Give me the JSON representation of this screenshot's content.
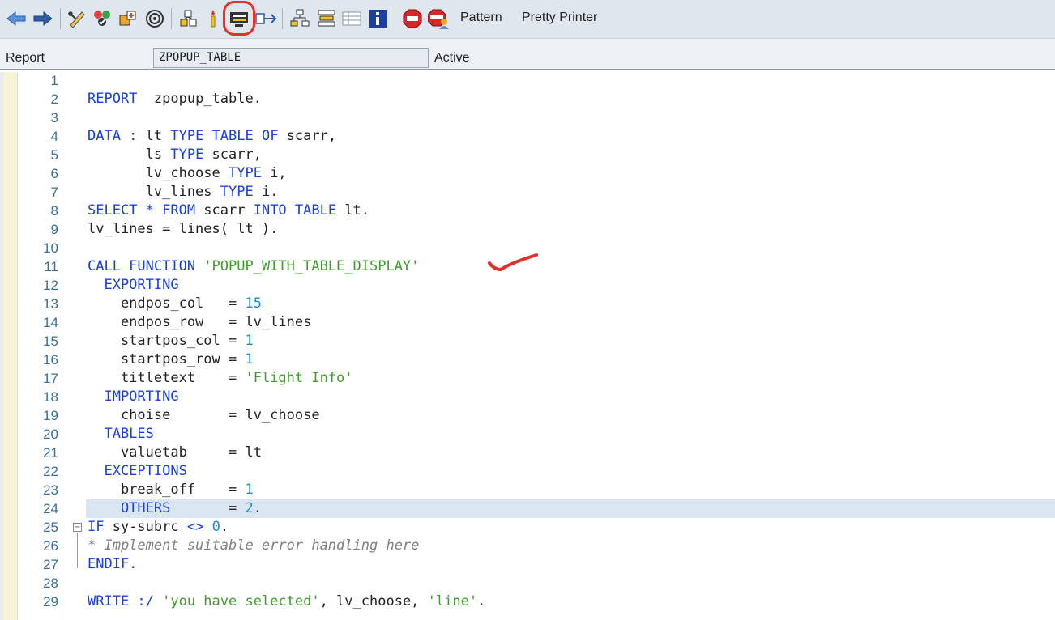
{
  "toolbar": {
    "icons": [
      {
        "name": "back-icon"
      },
      {
        "name": "forward-icon"
      },
      {
        "name": "display-change-icon"
      },
      {
        "name": "check-icon"
      },
      {
        "name": "activate-icon"
      },
      {
        "name": "where-used-icon"
      },
      {
        "name": "object-list-icon"
      },
      {
        "name": "test-icon"
      },
      {
        "name": "enhancement-icon"
      },
      {
        "name": "navigation-window-icon"
      },
      {
        "name": "hierarchy-icon"
      },
      {
        "name": "layout-icon"
      },
      {
        "name": "table-icon"
      },
      {
        "name": "info-icon"
      },
      {
        "name": "stop-breakpoint-icon"
      },
      {
        "name": "stop-user-icon"
      }
    ],
    "pattern_label": "Pattern",
    "pretty_printer_label": "Pretty Printer"
  },
  "header": {
    "object_type": "Report",
    "program_name": "ZPOPUP_TABLE",
    "status": "Active"
  },
  "editor": {
    "current_line": 24,
    "lines": [
      {
        "n": "1",
        "tokens": []
      },
      {
        "n": "2",
        "tokens": [
          {
            "t": "REPORT",
            "c": "kw"
          },
          {
            "t": "  zpopup_table.",
            "c": "pl"
          }
        ]
      },
      {
        "n": "3",
        "tokens": []
      },
      {
        "n": "4",
        "tokens": [
          {
            "t": "DATA : ",
            "c": "kw"
          },
          {
            "t": "lt ",
            "c": "pl"
          },
          {
            "t": "TYPE TABLE OF ",
            "c": "kw"
          },
          {
            "t": "scarr,",
            "c": "pl"
          }
        ]
      },
      {
        "n": "5",
        "tokens": [
          {
            "t": "       ls ",
            "c": "pl"
          },
          {
            "t": "TYPE ",
            "c": "kw"
          },
          {
            "t": "scarr,",
            "c": "pl"
          }
        ]
      },
      {
        "n": "6",
        "tokens": [
          {
            "t": "       lv_choose ",
            "c": "pl"
          },
          {
            "t": "TYPE ",
            "c": "kw"
          },
          {
            "t": "i,",
            "c": "pl"
          }
        ]
      },
      {
        "n": "7",
        "tokens": [
          {
            "t": "       lv_lines ",
            "c": "pl"
          },
          {
            "t": "TYPE ",
            "c": "kw"
          },
          {
            "t": "i.",
            "c": "pl"
          }
        ]
      },
      {
        "n": "8",
        "tokens": [
          {
            "t": "SELECT * FROM ",
            "c": "kw"
          },
          {
            "t": "scarr ",
            "c": "pl"
          },
          {
            "t": "INTO TABLE ",
            "c": "kw"
          },
          {
            "t": "lt.",
            "c": "pl"
          }
        ]
      },
      {
        "n": "9",
        "tokens": [
          {
            "t": "lv_lines = lines( lt ).",
            "c": "pl"
          }
        ]
      },
      {
        "n": "10",
        "tokens": []
      },
      {
        "n": "11",
        "tokens": [
          {
            "t": "CALL FUNCTION ",
            "c": "kw"
          },
          {
            "t": "'POPUP_WITH_TABLE_DISPLAY'",
            "c": "str"
          }
        ]
      },
      {
        "n": "12",
        "tokens": [
          {
            "t": "  EXPORTING",
            "c": "kw"
          }
        ]
      },
      {
        "n": "13",
        "tokens": [
          {
            "t": "    endpos_col   = ",
            "c": "pl"
          },
          {
            "t": "15",
            "c": "num"
          }
        ]
      },
      {
        "n": "14",
        "tokens": [
          {
            "t": "    endpos_row   = lv_lines",
            "c": "pl"
          }
        ]
      },
      {
        "n": "15",
        "tokens": [
          {
            "t": "    startpos_col = ",
            "c": "pl"
          },
          {
            "t": "1",
            "c": "num"
          }
        ]
      },
      {
        "n": "16",
        "tokens": [
          {
            "t": "    startpos_row = ",
            "c": "pl"
          },
          {
            "t": "1",
            "c": "num"
          }
        ]
      },
      {
        "n": "17",
        "tokens": [
          {
            "t": "    titletext    = ",
            "c": "pl"
          },
          {
            "t": "'Flight Info'",
            "c": "str"
          }
        ]
      },
      {
        "n": "18",
        "tokens": [
          {
            "t": "  IMPORTING",
            "c": "kw"
          }
        ]
      },
      {
        "n": "19",
        "tokens": [
          {
            "t": "    choise       = lv_choose",
            "c": "pl"
          }
        ]
      },
      {
        "n": "20",
        "tokens": [
          {
            "t": "  TABLES",
            "c": "kw"
          }
        ]
      },
      {
        "n": "21",
        "tokens": [
          {
            "t": "    valuetab     = lt",
            "c": "pl"
          }
        ]
      },
      {
        "n": "22",
        "tokens": [
          {
            "t": "  EXCEPTIONS",
            "c": "kw"
          }
        ]
      },
      {
        "n": "23",
        "tokens": [
          {
            "t": "    break_off    = ",
            "c": "pl"
          },
          {
            "t": "1",
            "c": "num"
          }
        ]
      },
      {
        "n": "24",
        "tokens": [
          {
            "t": "    OTHERS",
            "c": "kw"
          },
          {
            "t": "       = ",
            "c": "pl"
          },
          {
            "t": "2",
            "c": "num"
          },
          {
            "t": ".",
            "c": "pl"
          }
        ]
      },
      {
        "n": "25",
        "tokens": [
          {
            "t": "IF ",
            "c": "kw"
          },
          {
            "t": "sy-subrc ",
            "c": "pl"
          },
          {
            "t": "<> ",
            "c": "kw"
          },
          {
            "t": "0",
            "c": "num"
          },
          {
            "t": ".",
            "c": "pl"
          }
        ]
      },
      {
        "n": "26",
        "tokens": [
          {
            "t": "* Implement suitable error handling here",
            "c": "cm"
          }
        ]
      },
      {
        "n": "27",
        "tokens": [
          {
            "t": "ENDIF.",
            "c": "kw"
          }
        ]
      },
      {
        "n": "28",
        "tokens": []
      },
      {
        "n": "29",
        "tokens": [
          {
            "t": "WRITE :/ ",
            "c": "kw"
          },
          {
            "t": "'you have selected'",
            "c": "str"
          },
          {
            "t": ", lv_choose, ",
            "c": "pl"
          },
          {
            "t": "'line'",
            "c": "str"
          },
          {
            "t": ".",
            "c": "pl"
          }
        ]
      }
    ]
  },
  "colors": {
    "keyword": "#1a3ee0",
    "string": "#3f9d2a",
    "number": "#1c8bd6",
    "comment": "#808080",
    "annotation": "#e0312a"
  }
}
